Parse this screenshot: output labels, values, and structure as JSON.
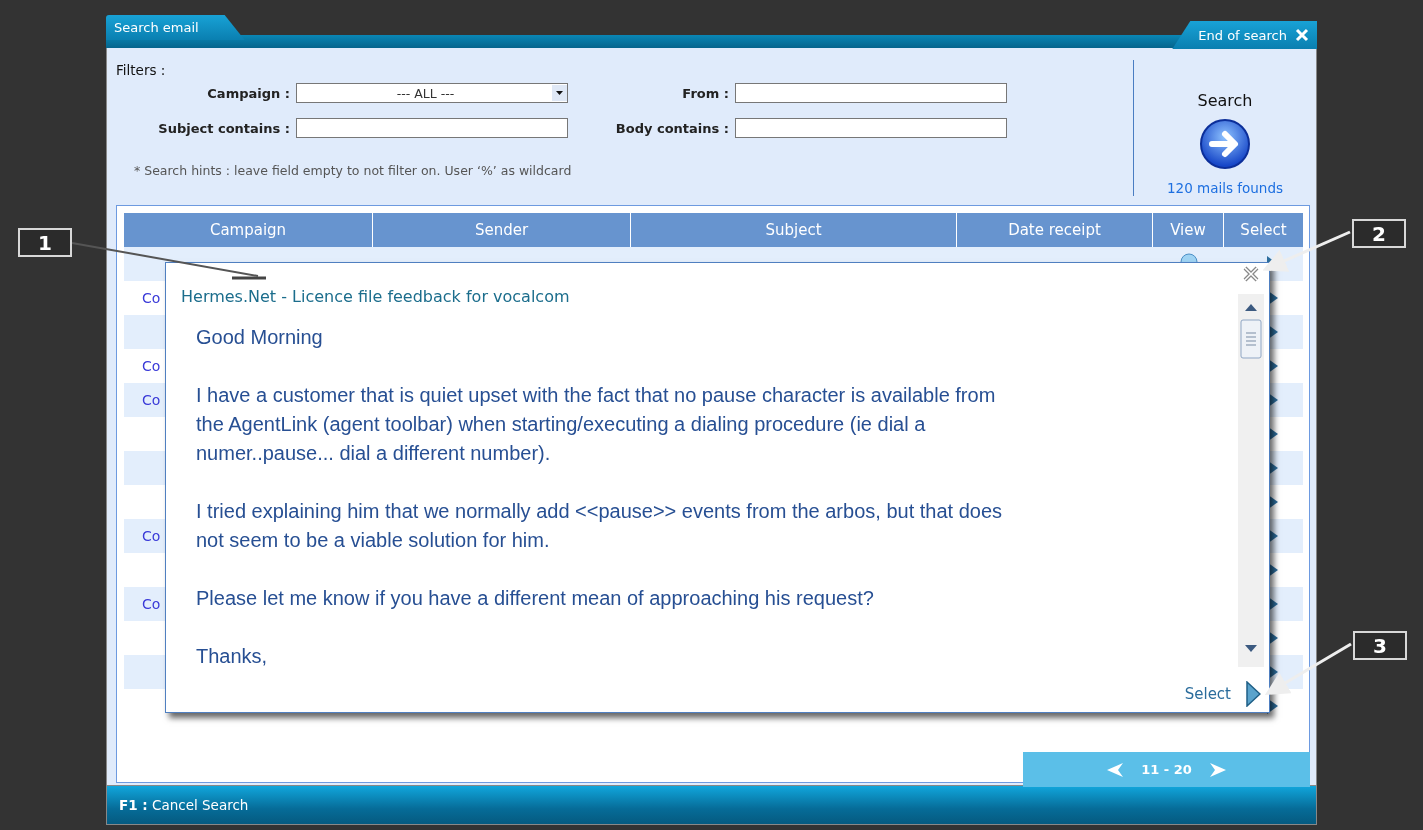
{
  "window": {
    "title": "Search email",
    "close_label": "End of search"
  },
  "filters": {
    "heading": "Filters :",
    "fields": [
      {
        "kind": "select",
        "label": "Campaign :",
        "value": "--- ALL ---"
      },
      {
        "kind": "text",
        "label": "From :"
      },
      {
        "kind": "text",
        "label": "Subject contains :"
      },
      {
        "kind": "text",
        "label": "Body contains :"
      }
    ],
    "hint": "* Search hints : leave field empty to not filter on. User ‘%’ as wildcard"
  },
  "search": {
    "label": "Search",
    "result_count": "120 mails founds"
  },
  "table": {
    "columns": [
      "Campaign",
      "Sender",
      "Subject",
      "Date receipt",
      "View",
      "Select"
    ],
    "rows": [
      {
        "campaign": ""
      },
      {
        "campaign": "Co"
      },
      {
        "campaign": ""
      },
      {
        "campaign": "Co"
      },
      {
        "campaign": "Co"
      },
      {
        "campaign": ""
      },
      {
        "campaign": ""
      },
      {
        "campaign": ""
      },
      {
        "campaign": "Co"
      },
      {
        "campaign": ""
      },
      {
        "campaign": "Co"
      },
      {
        "campaign": ""
      },
      {
        "campaign": ""
      },
      {
        "campaign": ""
      }
    ]
  },
  "preview": {
    "subject": "Hermes.Net - Licence file feedback for vocalcom",
    "paragraphs": [
      "Good Morning",
      "I have a customer that is quiet upset with the fact that no pause character is available from the AgentLink (agent toolbar) when starting/executing a dialing procedure (ie dial a numer..pause... dial a different number).",
      "I tried explaining him that we normally add <<pause>> events from the arbos, but that does not seem to be a viable solution for him.",
      "Please let me know if you have a different mean of approaching his request?",
      "Thanks,"
    ],
    "select_label": "Select"
  },
  "pager": {
    "range": "11 - 20"
  },
  "status_bar": {
    "text": "**F1 :** Cancel Search"
  },
  "annotations": [
    {
      "label": "1"
    },
    {
      "label": "2"
    },
    {
      "label": "3"
    }
  ]
}
